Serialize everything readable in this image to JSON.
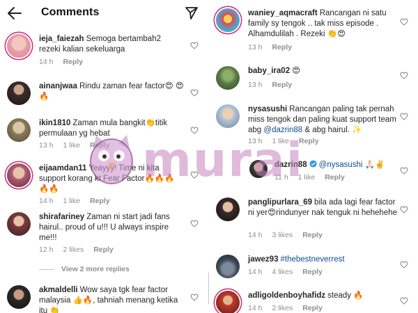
{
  "header": {
    "title": "Comments",
    "back_icon": "arrow-left-icon",
    "send_icon": "paper-plane-icon"
  },
  "left_comments": [
    {
      "username": "ieja_faiezah",
      "text": "Semoga bertambah2 rezeki kalian sekeluarga",
      "time": "14 h",
      "likes": "",
      "reply": "Reply"
    },
    {
      "username": "ainanjwaa",
      "text": "Rindu zaman fear factor😍 😍🔥",
      "time": "",
      "likes": "",
      "reply": ""
    },
    {
      "username": "ikin1810",
      "text": "Zaman mula bangkit👏titik permulaan yg hebat",
      "time": "13 h",
      "likes": "1 like",
      "reply": "Reply"
    },
    {
      "username": "eijaamdan11",
      "text": "Yeayyy! Time ni kita support korang kt Fear Factor🔥🔥🔥 🔥🔥",
      "time": "14 h",
      "likes": "1 like",
      "reply": "Reply"
    },
    {
      "username": "shirafariney",
      "text": "Zaman ni start jadi fans hairul.. proud of u!!! U always inspire me!!!",
      "time": "12 h",
      "likes": "2 likes",
      "reply": "Reply"
    },
    {
      "username": "akmaldelli",
      "text": "Wow saya tgk fear factor malaysia 👍🔥, tahniah menang ketika itu 👏",
      "time": "",
      "likes": "",
      "reply": ""
    }
  ],
  "view_more": "View 2 more replies",
  "right_comments": [
    {
      "username": "waniey_aqmacraft",
      "text": "Rancangan ni satu family sy tengok .. tak miss episode . Alhamdulilah . Rezeki 👏😍",
      "time": "13 h",
      "likes": "",
      "reply": "Reply"
    },
    {
      "username": "baby_ira02",
      "text": "😍",
      "time": "13 h",
      "likes": "",
      "reply": "Reply"
    },
    {
      "username": "nysasushi",
      "text_before": "Rancangan paling tak pernah miss tengok dan paling kuat support team abg ",
      "mention": "@dazrin88",
      "text_after": " & abg hairul. ✨",
      "time": "13 h",
      "likes": "1 like",
      "reply": "Reply"
    },
    {
      "username": "dazrin88",
      "mention": "@nysasushi",
      "text_after": " 🙏🏻✌️",
      "time": "11 h",
      "likes": "1 like",
      "reply": "Reply"
    },
    {
      "username": "panglipurlara_69",
      "text": "bila ada lagi fear factor ni yer😍rindunyer nak tenguk ni hehehehe",
      "time": "14 h",
      "likes": "3 likes",
      "reply": "Reply"
    },
    {
      "username": "jawez93",
      "hashtag": "#thebestneverrest",
      "time": "14 h",
      "likes": "4 likes",
      "reply": "Reply"
    },
    {
      "username": "adligoldenboyhafidz",
      "text": "steady 🔥",
      "time": "14 h",
      "likes": "2 likes",
      "reply": "Reply"
    }
  ],
  "watermark": {
    "text": "murai"
  },
  "colors": {
    "mention": "#0b4d8f",
    "meta": "#8e8e8e",
    "watermark": "#c482be"
  }
}
